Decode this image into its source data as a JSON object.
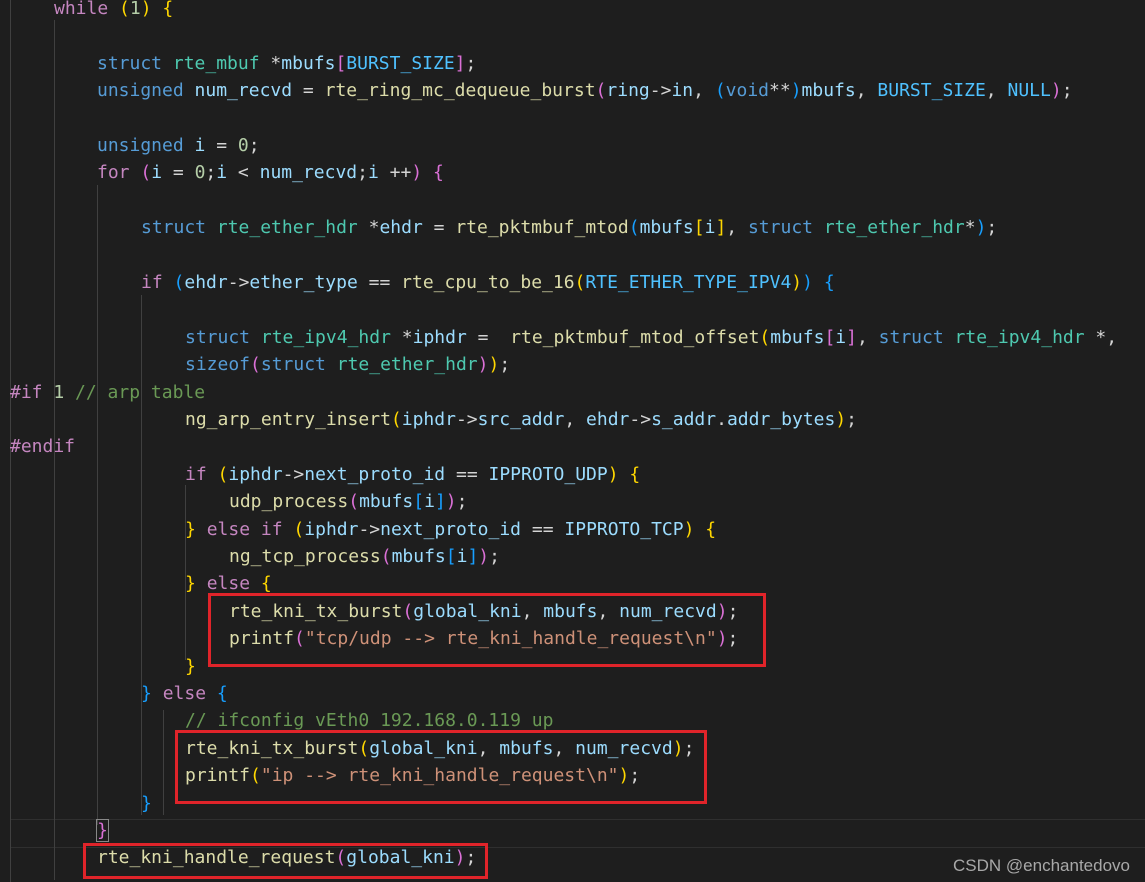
{
  "colors": {
    "background": "#1e1e1e",
    "keyword": "#569cd6",
    "control": "#c586c0",
    "type": "#4ec9b0",
    "function": "#dcdcaa",
    "variable": "#9cdcfe",
    "number": "#b5cea8",
    "string": "#ce9178",
    "macro": "#4fc1ff",
    "comment": "#6a9955",
    "highlight_box": "#e0242a"
  },
  "watermark": "CSDN @enchantedovo",
  "code_lines": [
    [
      [
        "ctrl",
        "while"
      ],
      [
        "op",
        " "
      ],
      [
        "b1",
        "("
      ],
      [
        "num",
        "1"
      ],
      [
        "b1",
        ")"
      ],
      [
        "op",
        " "
      ],
      [
        "b1",
        "{"
      ]
    ],
    [],
    [
      [
        "kw",
        "struct"
      ],
      [
        "op",
        " "
      ],
      [
        "ty",
        "rte_mbuf"
      ],
      [
        "op",
        " *"
      ],
      [
        "var",
        "mbufs"
      ],
      [
        "b2",
        "["
      ],
      [
        "mac",
        "BURST_SIZE"
      ],
      [
        "b2",
        "]"
      ],
      [
        "op",
        ";"
      ]
    ],
    [
      [
        "kw",
        "unsigned"
      ],
      [
        "op",
        " "
      ],
      [
        "var",
        "num_recvd"
      ],
      [
        "op",
        " = "
      ],
      [
        "fn",
        "rte_ring_mc_dequeue_burst"
      ],
      [
        "b2",
        "("
      ],
      [
        "var",
        "ring"
      ],
      [
        "op",
        "->"
      ],
      [
        "var",
        "in"
      ],
      [
        "op",
        ", "
      ],
      [
        "b3",
        "("
      ],
      [
        "kw",
        "void"
      ],
      [
        "op",
        "**"
      ],
      [
        "b3",
        ")"
      ],
      [
        "var",
        "mbufs"
      ],
      [
        "op",
        ", "
      ],
      [
        "mac",
        "BURST_SIZE"
      ],
      [
        "op",
        ", "
      ],
      [
        "mac",
        "NULL"
      ],
      [
        "b2",
        ")"
      ],
      [
        "op",
        ";"
      ]
    ],
    [],
    [
      [
        "kw",
        "unsigned"
      ],
      [
        "op",
        " "
      ],
      [
        "var",
        "i"
      ],
      [
        "op",
        " = "
      ],
      [
        "num",
        "0"
      ],
      [
        "op",
        ";"
      ]
    ],
    [
      [
        "ctrl",
        "for"
      ],
      [
        "op",
        " "
      ],
      [
        "b2",
        "("
      ],
      [
        "var",
        "i"
      ],
      [
        "op",
        " = "
      ],
      [
        "num",
        "0"
      ],
      [
        "op",
        ";"
      ],
      [
        "var",
        "i"
      ],
      [
        "op",
        " < "
      ],
      [
        "var",
        "num_recvd"
      ],
      [
        "op",
        ";"
      ],
      [
        "var",
        "i"
      ],
      [
        "op",
        " ++"
      ],
      [
        "b2",
        ")"
      ],
      [
        "op",
        " "
      ],
      [
        "b2",
        "{"
      ]
    ],
    [],
    [
      [
        "kw",
        "struct"
      ],
      [
        "op",
        " "
      ],
      [
        "ty",
        "rte_ether_hdr"
      ],
      [
        "op",
        " *"
      ],
      [
        "var",
        "ehdr"
      ],
      [
        "op",
        " = "
      ],
      [
        "fn",
        "rte_pktmbuf_mtod"
      ],
      [
        "b3",
        "("
      ],
      [
        "var",
        "mbufs"
      ],
      [
        "b1",
        "["
      ],
      [
        "var",
        "i"
      ],
      [
        "b1",
        "]"
      ],
      [
        "op",
        ", "
      ],
      [
        "kw",
        "struct"
      ],
      [
        "op",
        " "
      ],
      [
        "ty",
        "rte_ether_hdr"
      ],
      [
        "op",
        "*"
      ],
      [
        "b3",
        ")"
      ],
      [
        "op",
        ";"
      ]
    ],
    [],
    [
      [
        "ctrl",
        "if"
      ],
      [
        "op",
        " "
      ],
      [
        "b3",
        "("
      ],
      [
        "var",
        "ehdr"
      ],
      [
        "op",
        "->"
      ],
      [
        "var",
        "ether_type"
      ],
      [
        "op",
        " == "
      ],
      [
        "fn",
        "rte_cpu_to_be_16"
      ],
      [
        "b1",
        "("
      ],
      [
        "mac",
        "RTE_ETHER_TYPE_IPV4"
      ],
      [
        "b1",
        ")"
      ],
      [
        "b3",
        ")"
      ],
      [
        "op",
        " "
      ],
      [
        "b3",
        "{"
      ]
    ],
    [],
    [
      [
        "kw",
        "struct"
      ],
      [
        "op",
        " "
      ],
      [
        "ty",
        "rte_ipv4_hdr"
      ],
      [
        "op",
        " *"
      ],
      [
        "var",
        "iphdr"
      ],
      [
        "op",
        " =  "
      ],
      [
        "fn",
        "rte_pktmbuf_mtod_offset"
      ],
      [
        "b1",
        "("
      ],
      [
        "var",
        "mbufs"
      ],
      [
        "b2",
        "["
      ],
      [
        "var",
        "i"
      ],
      [
        "b2",
        "]"
      ],
      [
        "op",
        ", "
      ],
      [
        "kw",
        "struct"
      ],
      [
        "op",
        " "
      ],
      [
        "ty",
        "rte_ipv4_hdr"
      ],
      [
        "op",
        " *,"
      ]
    ],
    [
      [
        "kw",
        "sizeof"
      ],
      [
        "b2",
        "("
      ],
      [
        "kw",
        "struct"
      ],
      [
        "op",
        " "
      ],
      [
        "ty",
        "rte_ether_hdr"
      ],
      [
        "b2",
        ")"
      ],
      [
        "b1",
        ")"
      ],
      [
        "op",
        ";"
      ]
    ],
    [
      [
        "pp",
        "#if"
      ],
      [
        "op",
        " "
      ],
      [
        "num",
        "1"
      ],
      [
        "op",
        " "
      ],
      [
        "cm",
        "// arp table"
      ]
    ],
    [
      [
        "fn",
        "ng_arp_entry_insert"
      ],
      [
        "b1",
        "("
      ],
      [
        "var",
        "iphdr"
      ],
      [
        "op",
        "->"
      ],
      [
        "var",
        "src_addr"
      ],
      [
        "op",
        ", "
      ],
      [
        "var",
        "ehdr"
      ],
      [
        "op",
        "->"
      ],
      [
        "var",
        "s_addr"
      ],
      [
        "op",
        "."
      ],
      [
        "var",
        "addr_bytes"
      ],
      [
        "b1",
        ")"
      ],
      [
        "op",
        ";"
      ]
    ],
    [
      [
        "pp",
        "#endif"
      ]
    ],
    [
      [
        "ctrl",
        "if"
      ],
      [
        "op",
        " "
      ],
      [
        "b1",
        "("
      ],
      [
        "var",
        "iphdr"
      ],
      [
        "op",
        "->"
      ],
      [
        "var",
        "next_proto_id"
      ],
      [
        "op",
        " == "
      ],
      [
        "var",
        "IPPROTO_UDP"
      ],
      [
        "b1",
        ")"
      ],
      [
        "op",
        " "
      ],
      [
        "b1",
        "{"
      ]
    ],
    [
      [
        "fn",
        "udp_process"
      ],
      [
        "b2",
        "("
      ],
      [
        "var",
        "mbufs"
      ],
      [
        "b3",
        "["
      ],
      [
        "var",
        "i"
      ],
      [
        "b3",
        "]"
      ],
      [
        "b2",
        ")"
      ],
      [
        "op",
        ";"
      ]
    ],
    [
      [
        "b1",
        "}"
      ],
      [
        "op",
        " "
      ],
      [
        "ctrl",
        "else"
      ],
      [
        "op",
        " "
      ],
      [
        "ctrl",
        "if"
      ],
      [
        "op",
        " "
      ],
      [
        "b1",
        "("
      ],
      [
        "var",
        "iphdr"
      ],
      [
        "op",
        "->"
      ],
      [
        "var",
        "next_proto_id"
      ],
      [
        "op",
        " == "
      ],
      [
        "var",
        "IPPROTO_TCP"
      ],
      [
        "b1",
        ")"
      ],
      [
        "op",
        " "
      ],
      [
        "b1",
        "{"
      ]
    ],
    [
      [
        "fn",
        "ng_tcp_process"
      ],
      [
        "b2",
        "("
      ],
      [
        "var",
        "mbufs"
      ],
      [
        "b3",
        "["
      ],
      [
        "var",
        "i"
      ],
      [
        "b3",
        "]"
      ],
      [
        "b2",
        ")"
      ],
      [
        "op",
        ";"
      ]
    ],
    [
      [
        "b1",
        "}"
      ],
      [
        "op",
        " "
      ],
      [
        "ctrl",
        "else"
      ],
      [
        "op",
        " "
      ],
      [
        "b1",
        "{"
      ]
    ],
    [
      [
        "fn",
        "rte_kni_tx_burst"
      ],
      [
        "b2",
        "("
      ],
      [
        "var",
        "global_kni"
      ],
      [
        "op",
        ", "
      ],
      [
        "var",
        "mbufs"
      ],
      [
        "op",
        ", "
      ],
      [
        "var",
        "num_recvd"
      ],
      [
        "b2",
        ")"
      ],
      [
        "op",
        ";"
      ]
    ],
    [
      [
        "fn",
        "printf"
      ],
      [
        "b2",
        "("
      ],
      [
        "str",
        "\"tcp/udp --> rte_kni_handle_request\\n\""
      ],
      [
        "b2",
        ")"
      ],
      [
        "op",
        ";"
      ]
    ],
    [
      [
        "b1",
        "}"
      ]
    ],
    [
      [
        "b3",
        "}"
      ],
      [
        "op",
        " "
      ],
      [
        "ctrl",
        "else"
      ],
      [
        "op",
        " "
      ],
      [
        "b3",
        "{"
      ]
    ],
    [
      [
        "cm",
        "// ifconfig vEth0 192.168.0.119 up"
      ]
    ],
    [
      [
        "fn",
        "rte_kni_tx_burst"
      ],
      [
        "b1",
        "("
      ],
      [
        "var",
        "global_kni"
      ],
      [
        "op",
        ", "
      ],
      [
        "var",
        "mbufs"
      ],
      [
        "op",
        ", "
      ],
      [
        "var",
        "num_recvd"
      ],
      [
        "b1",
        ")"
      ],
      [
        "op",
        ";"
      ]
    ],
    [
      [
        "fn",
        "printf"
      ],
      [
        "b1",
        "("
      ],
      [
        "str",
        "\"ip --> rte_kni_handle_request\\n\""
      ],
      [
        "b1",
        ")"
      ],
      [
        "op",
        ";"
      ]
    ],
    [
      [
        "b3",
        "}"
      ]
    ],
    [
      [
        "b2",
        "}"
      ]
    ],
    [
      [
        "fn",
        "rte_kni_handle_request"
      ],
      [
        "b2",
        "("
      ],
      [
        "var",
        "global_kni"
      ],
      [
        "b2",
        ")"
      ],
      [
        "op",
        ";"
      ]
    ]
  ]
}
